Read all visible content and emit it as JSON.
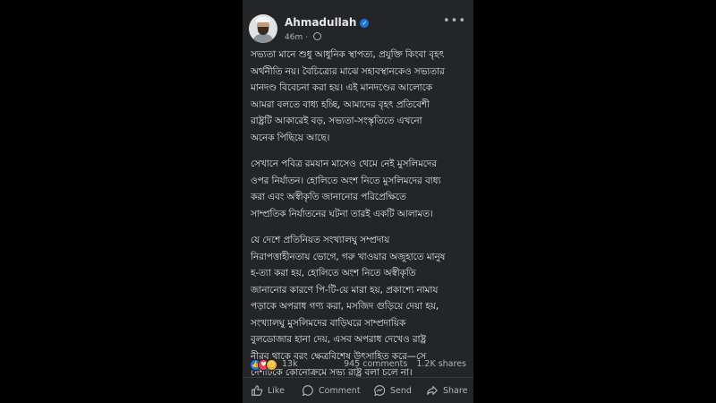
{
  "post": {
    "author": "Ahmadullah",
    "time": "46m",
    "paragraphs": [
      "সভ্যতা মানে শুধু আধুনিক স্থাপত্য, প্রযুক্তি কিংবা বৃহৎ\nঅর্থনীতি নয়। বৈচিত্র্যের মাঝে সহাবস্থানকেও সভ্যতার\nমানদণ্ড বিবেচনা করা হয়। এই মানদণ্ডের আলোকে\nআমরা বলতে বাধ্য হচ্ছি, আমাদের বৃহৎ প্রতিবেশী\nরাষ্ট্রটি আকারেই বড়, সভ্যতা-সংস্কৃতিতে এখনো\nঅনেক পিছিয়ে আছে।",
      "সেখানে পবিত্র রমযান মাসেও থেমে নেই মুসলিমদের\nওপর নির্যাতন। হোলিতে অংশ নিতে মুসলিমদের বাধ্য\nকরা এবং অস্বীকৃতি জানানোর পরিপ্রেক্ষিতে\nসাম্প্রতিক নির্যাতনের ঘটনা তারই একটি আলামত।",
      "যে দেশে প্রতিনিয়ত সংখ্যালঘু সম্প্রদায়\nনিরাপত্তাহীনতায় ভোগে, গরু খাওয়ার অজুহাতে মানুষ\nহ-ত্যা করা হয়, হোলিতে অংশ নিতে অস্বীকৃতি\nজানানোর কারণে পি-টি-য়ে মারা হয়, প্রকাশ্যে নামায\nপড়াকে অপরাধ গণ্য করা, মসজিদ গুড়িয়ে দেয়া হয়,\nসংখ্যালঘু মুসলিমদের বাড়িঘরে সাম্প্রদায়িক\nবুলডোজার হানা দেয়, এসব অপরাধ দেখেও রাষ্ট্র\nনীরব থাকে বরং ক্ষেত্রবিশেষ উৎসাহিত করে—সে\nদেশটিকে কোনোক্রমে সভ্য রাষ্ট্র বলা চলে না।"
    ]
  },
  "stats": {
    "reactions": "13k",
    "comments": "945 comments",
    "shares": "1.2K shares"
  },
  "actions": {
    "like": "Like",
    "comment": "Comment",
    "send": "Send",
    "share": "Share"
  },
  "icons": {
    "verified": "verified-badge-icon",
    "audience": "globe-icon",
    "more": "more-options-icon"
  },
  "colors": {
    "background": "#000000",
    "card": "#242526",
    "text": "#e4e6eb",
    "secondary": "#b0b3b8",
    "verified": "#1b74e4"
  }
}
